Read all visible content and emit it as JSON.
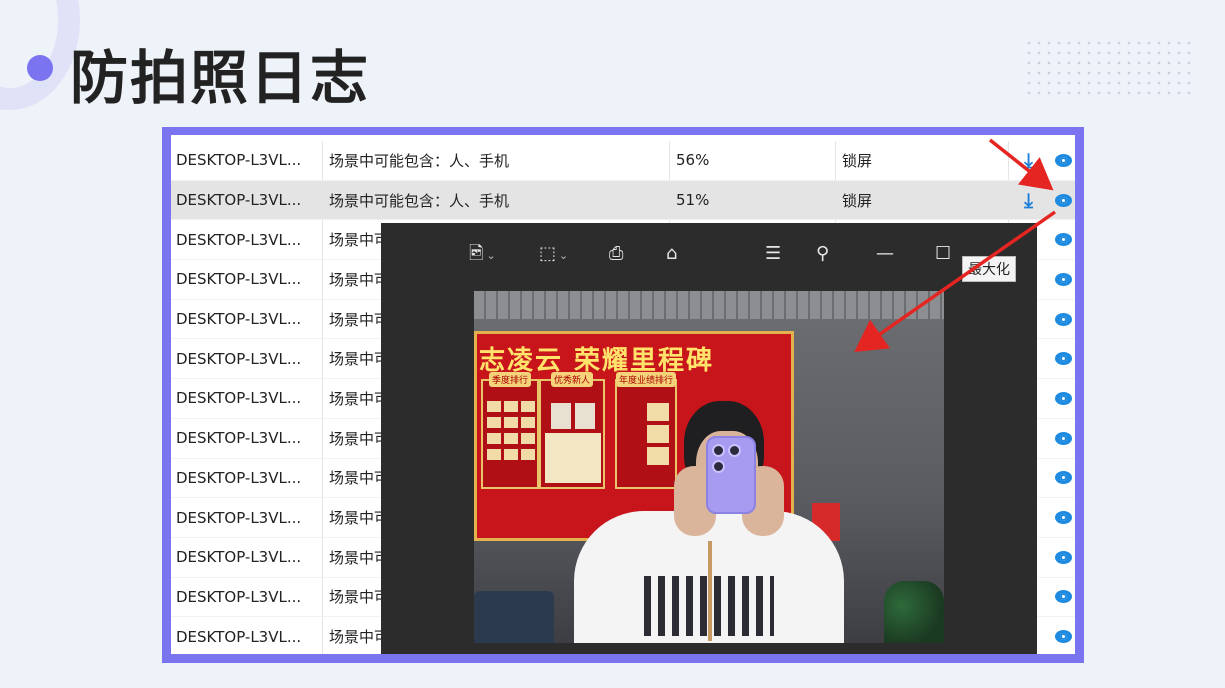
{
  "title": "防拍照日志",
  "table": {
    "rows": [
      {
        "host": "DESKTOP-L3VL...",
        "desc": "场景中可能包含：人、手机",
        "confidence": "56%",
        "action": "锁屏"
      },
      {
        "host": "DESKTOP-L3VL...",
        "desc": "场景中可能包含：人、手机",
        "confidence": "51%",
        "action": "锁屏"
      },
      {
        "host": "DESKTOP-L3VL...",
        "desc": "场景中可",
        "confidence": "",
        "action": ""
      },
      {
        "host": "DESKTOP-L3VL...",
        "desc": "场景中可",
        "confidence": "",
        "action": ""
      },
      {
        "host": "DESKTOP-L3VL...",
        "desc": "场景中可",
        "confidence": "",
        "action": ""
      },
      {
        "host": "DESKTOP-L3VL...",
        "desc": "场景中可",
        "confidence": "",
        "action": ""
      },
      {
        "host": "DESKTOP-L3VL...",
        "desc": "场景中可",
        "confidence": "",
        "action": ""
      },
      {
        "host": "DESKTOP-L3VL...",
        "desc": "场景中可",
        "confidence": "",
        "action": ""
      },
      {
        "host": "DESKTOP-L3VL...",
        "desc": "场景中可",
        "confidence": "",
        "action": ""
      },
      {
        "host": "DESKTOP-L3VL...",
        "desc": "场景中可",
        "confidence": "",
        "action": ""
      },
      {
        "host": "DESKTOP-L3VL...",
        "desc": "场景中可",
        "confidence": "",
        "action": ""
      },
      {
        "host": "DESKTOP-L3VL...",
        "desc": "场景中可",
        "confidence": "",
        "action": ""
      },
      {
        "host": "DESKTOP-L3VL...",
        "desc": "场景中可",
        "confidence": "",
        "action": ""
      }
    ],
    "selected_row": 1
  },
  "viewer": {
    "tooltip": "最大化",
    "photo_banner": "志凌云 荣耀里程碑",
    "panel_captions": [
      "季度排行",
      "优秀新人",
      "年度业绩排行"
    ]
  },
  "colors": {
    "accent": "#7b74f0",
    "arrow": "#e52521",
    "icon_blue": "#1e8be0"
  }
}
